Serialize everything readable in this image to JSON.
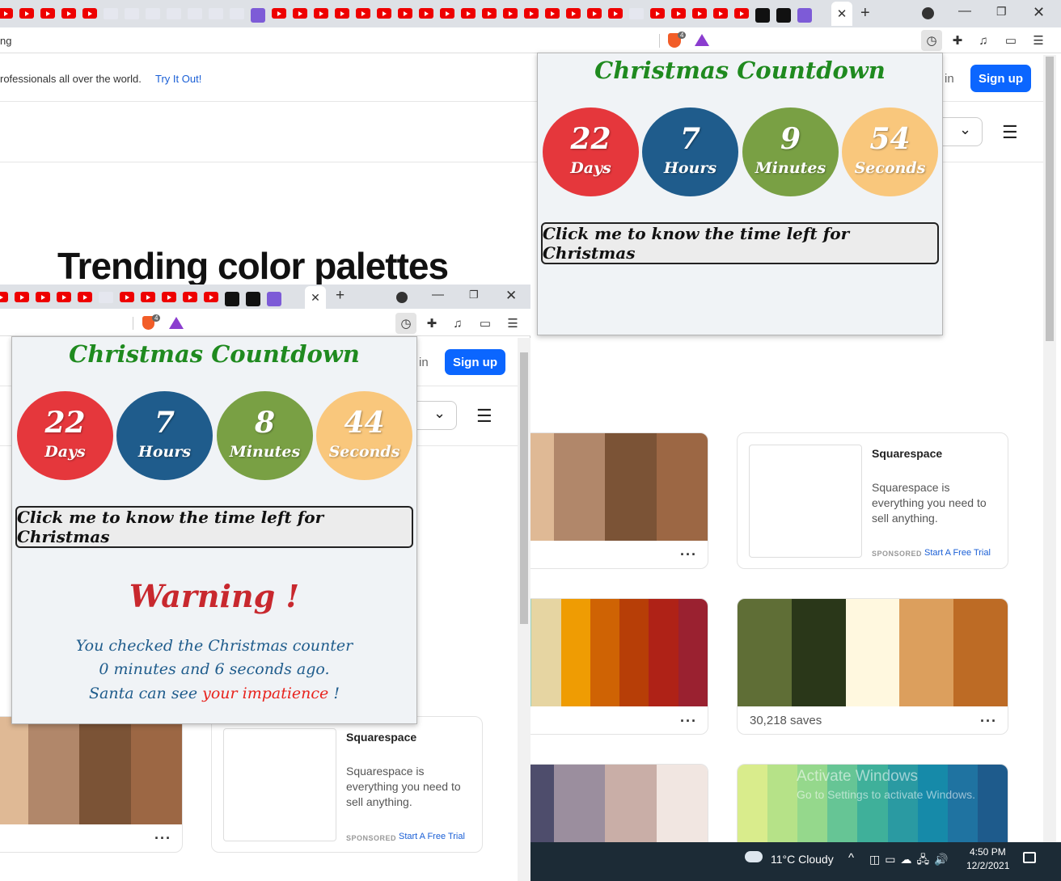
{
  "back_browser": {
    "url_fragment": "ng",
    "brave_badge": "4",
    "banner_text": "rofessionals all over the world.",
    "banner_link": "Try It Out!",
    "login_fragment": "in",
    "signup": "Sign up",
    "heading": "Trending color palettes"
  },
  "front_browser": {
    "brave_badge": "4",
    "login_fragment": "in",
    "signup": "Sign up"
  },
  "popup_top": {
    "title": "Christmas Countdown",
    "days": "22",
    "days_label": "Days",
    "hours": "7",
    "hours_label": "Hours",
    "minutes": "9",
    "minutes_label": "Minutes",
    "seconds": "54",
    "seconds_label": "Seconds",
    "button": "Click me to know the time left for Christmas"
  },
  "popup_front": {
    "title": "Christmas Countdown",
    "days": "22",
    "days_label": "Days",
    "hours": "7",
    "hours_label": "Hours",
    "minutes": "8",
    "minutes_label": "Minutes",
    "seconds": "44",
    "seconds_label": "Seconds",
    "button": "Click me to know the time left for Christmas",
    "warning_title": "Warning !",
    "warning_line1": "You checked the Christmas counter",
    "warning_line2": "0 minutes and 6 seconds ago.",
    "warning_line3_a": "Santa can see ",
    "warning_line3_b": "your impatience",
    "warning_line3_c": " !"
  },
  "ad": {
    "title": "Squarespace",
    "desc": "Squarespace is everything you need to sell anything.",
    "sponsored": "SPONSORED",
    "cta": "Start A Free Trial"
  },
  "palettes": {
    "brown": [
      "#dfb995",
      "#b1876a",
      "#7b5336",
      "#9c6744"
    ],
    "warm": [
      "#98d3c0",
      "#e6d5a2",
      "#ef9c03",
      "#cf6304",
      "#b73e07",
      "#af2217",
      "#9a2130"
    ],
    "olive": [
      "#5f6e36",
      "#2a3719",
      "#fff8df",
      "#dc9f5d",
      "#bd6b25"
    ],
    "muted": [
      "#4e4d6c",
      "#9b8e9e",
      "#c9aea7",
      "#f1e6e1"
    ],
    "green": [
      "#d9ec8c",
      "#b6e288",
      "#95d88c",
      "#66c595",
      "#3fb09a",
      "#2a9aa2",
      "#168aa9",
      "#1f73a1",
      "#1e5b8c"
    ]
  },
  "saves": "30,218 saves",
  "watermark_1": "Activate Windows",
  "watermark_2": "Go to Settings to activate Windows.",
  "taskbar": {
    "weather": "11°C  Cloudy",
    "time": "4:50 PM",
    "date": "12/2/2021"
  },
  "colors": {
    "days": "#e5373c",
    "hours": "#1f5c8c",
    "minutes": "#79a044",
    "seconds": "#f9c77c",
    "accent": "#0b66ff"
  }
}
